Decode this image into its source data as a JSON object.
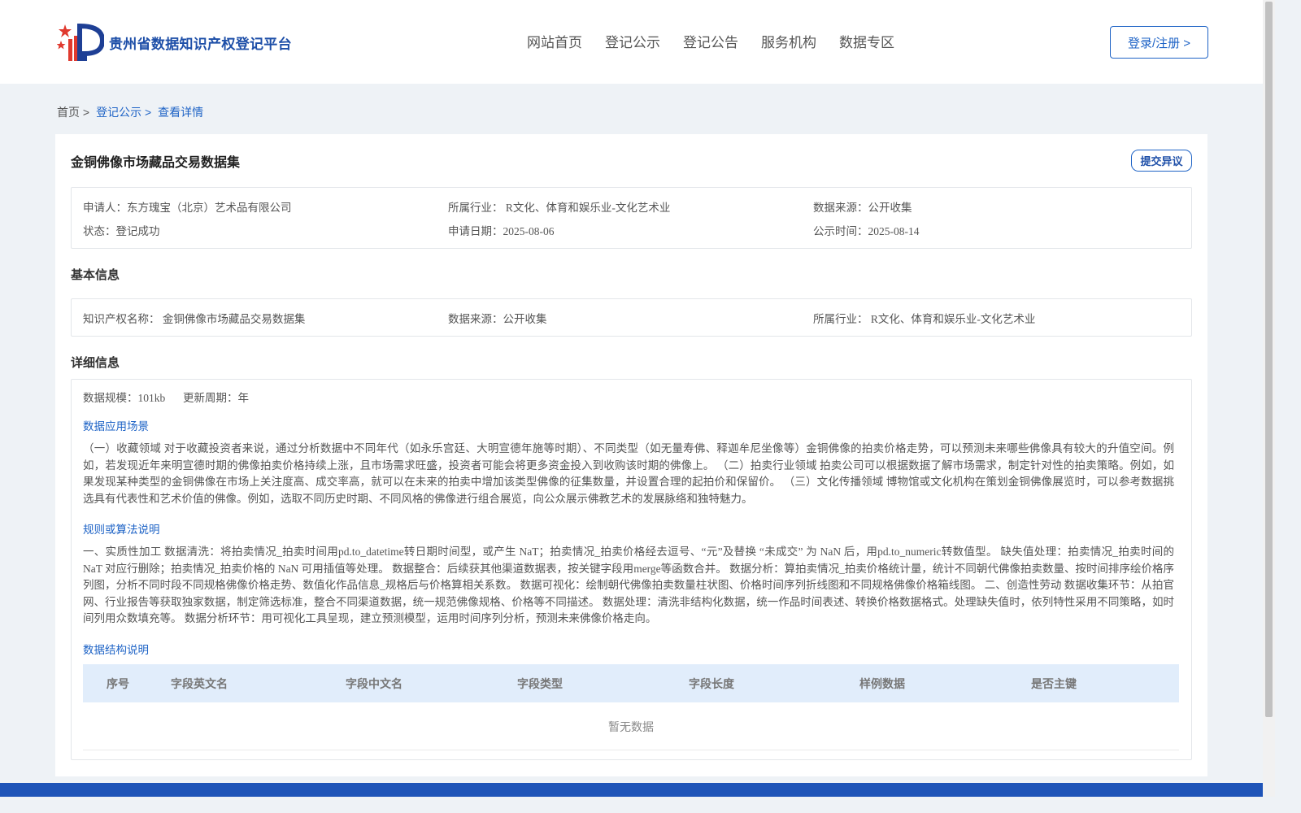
{
  "header": {
    "logo_text": "贵州省数据知识产权登记平台",
    "nav": [
      "网站首页",
      "登记公示",
      "登记公告",
      "服务机构",
      "数据专区"
    ],
    "login_label": "登录/注册 >"
  },
  "breadcrumb": {
    "home": "首页 >",
    "list": "登记公示 >",
    "current": "查看详情"
  },
  "detail": {
    "title": "金铜佛像市场藏品交易数据集",
    "objection_label": "提交异议",
    "summary": {
      "applicant": "申请人：东方瑰宝（北京）艺术品有限公司",
      "industry": "所属行业： R文化、体育和娱乐业-文化艺术业",
      "source": "数据来源：公开收集",
      "status": "状态：登记成功",
      "apply_date": "申请日期：2025-08-06",
      "publish_date": "公示时间：2025-08-14"
    },
    "basic_title": "基本信息",
    "basic": {
      "ip_name": "知识产权名称： 金铜佛像市场藏品交易数据集",
      "source": "数据来源：公开收集",
      "industry": "所属行业： R文化、体育和娱乐业-文化艺术业"
    },
    "detail_title": "详细信息",
    "scale": "数据规模：101kb",
    "cycle": "更新周期：年",
    "scene_title": "数据应用场景",
    "scene_text": "（一）收藏领域 对于收藏投资者来说，通过分析数据中不同年代（如永乐宫廷、大明宣德年施等时期）、不同类型（如无量寿佛、释迦牟尼坐像等）金铜佛像的拍卖价格走势，可以预测未来哪些佛像具有较大的升值空间。例如，若发现近年来明宣德时期的佛像拍卖价格持续上涨，且市场需求旺盛，投资者可能会将更多资金投入到收购该时期的佛像上。 （二）拍卖行业领域 拍卖公司可以根据数据了解市场需求，制定针对性的拍卖策略。例如，如果发现某种类型的金铜佛像在市场上关注度高、成交率高，就可以在未来的拍卖中增加该类型佛像的征集数量，并设置合理的起拍价和保留价。 （三）文化传播领域 博物馆或文化机构在策划金铜佛像展览时，可以参考数据挑选具有代表性和艺术价值的佛像。例如，选取不同历史时期、不同风格的佛像进行组合展览，向公众展示佛教艺术的发展脉络和独特魅力。",
    "rule_title": "规则或算法说明",
    "rule_text": "一、实质性加工 数据清洗：将拍卖情况_拍卖时间用pd.to_datetime转日期时间型，或产生 NaT；拍卖情况_拍卖价格经去逗号、“元”及替换 “未成交” 为 NaN 后，用pd.to_numeric转数值型。 缺失值处理：拍卖情况_拍卖时间的 NaT 对应行删除；拍卖情况_拍卖价格的 NaN 可用插值等处理。 数据整合：后续获其他渠道数据表，按关键字段用merge等函数合并。 数据分析：算拍卖情况_拍卖价格统计量，统计不同朝代佛像拍卖数量、按时间排序绘价格序列图，分析不同时段不同规格佛像价格走势、数值化作品信息_规格后与价格算相关系数。 数据可视化：绘制朝代佛像拍卖数量柱状图、价格时间序列折线图和不同规格佛像价格箱线图。 二、创造性劳动 数据收集环节：从拍官网、行业报告等获取独家数据，制定筛选标准，整合不同渠道数据，统一规范佛像规格、价格等不同描述。 数据处理：清洗非结构化数据，统一作品时间表述、转换价格数据格式。处理缺失值时，依列特性采用不同策略，如时间列用众数填充等。 数据分析环节：用可视化工具呈现，建立预测模型，运用时间序列分析，预测未来佛像价格走向。",
    "structure_title": "数据结构说明",
    "table_columns": [
      "序号",
      "字段英文名",
      "字段中文名",
      "字段类型",
      "字段长度",
      "样例数据",
      "是否主键"
    ],
    "empty_text": "暂无数据"
  },
  "colors": {
    "brand_blue": "#1e4fa8",
    "link_blue": "#1e63c6",
    "table_head_bg": "#e1edfb",
    "page_bg": "#eef2f6",
    "footer_bg": "#1e54b8"
  }
}
